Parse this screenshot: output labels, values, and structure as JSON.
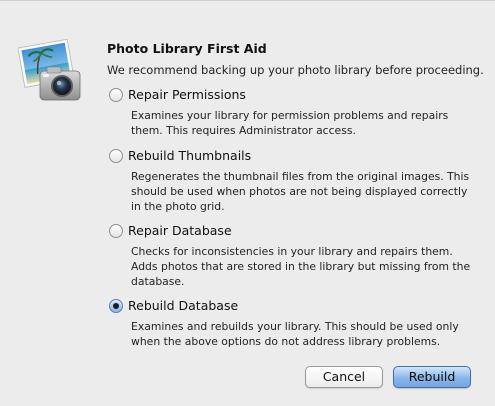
{
  "dialog": {
    "title": "Photo Library First Aid",
    "subtitle": "We recommend backing up your photo library before proceeding.",
    "app_icon": "iphoto-camera-icon"
  },
  "options": [
    {
      "label": "Repair Permissions",
      "checked": false,
      "description": [
        "Examines your library for permission problems and repairs",
        "them. This requires Administrator access."
      ]
    },
    {
      "label": "Rebuild Thumbnails",
      "checked": false,
      "description": [
        "Regenerates the thumbnail files from the original images. This",
        "should be used when photos are not being displayed correctly",
        "in the photo grid."
      ]
    },
    {
      "label": "Repair Database",
      "checked": false,
      "description": [
        "Checks for inconsistencies in your library and repairs them.",
        "Adds photos that are stored in the library but missing from the",
        "database."
      ]
    },
    {
      "label": "Rebuild Database",
      "checked": true,
      "description": [
        "Examines and rebuilds your library. This should be used only",
        "when the above options do not address library problems."
      ]
    }
  ],
  "buttons": {
    "cancel_label": "Cancel",
    "rebuild_label": "Rebuild"
  },
  "colors": {
    "dialog_background": "#ececec",
    "default_button": "#8ab6ea",
    "radio_selected": "#8db5e6"
  }
}
